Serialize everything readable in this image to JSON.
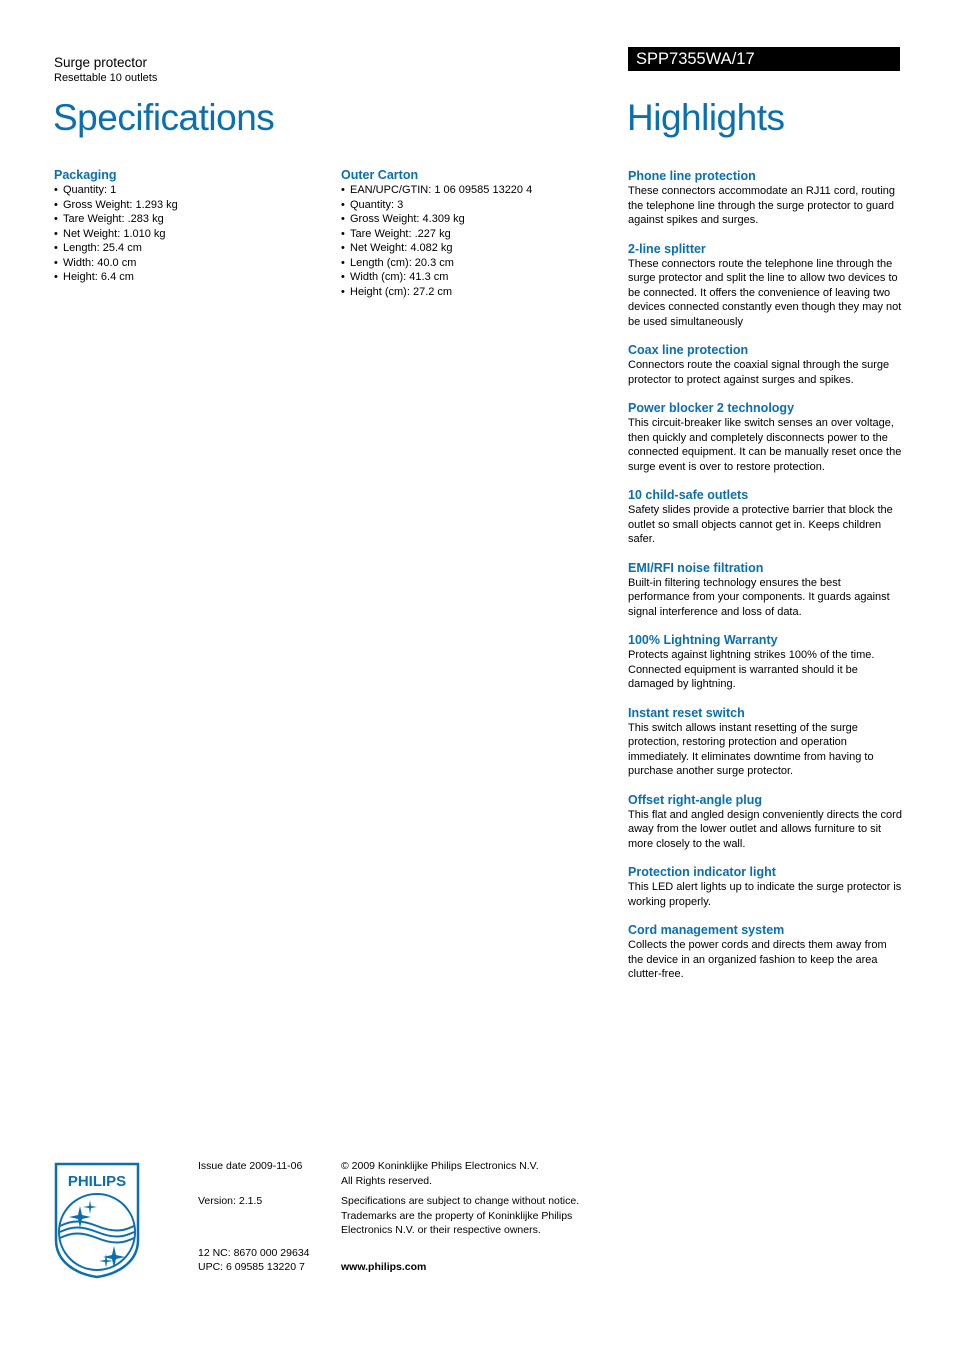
{
  "header": {
    "product_name": "Surge protector",
    "product_subtitle": "Resettable 10 outlets",
    "specifications_title": "Specifications",
    "model_number": "SPP7355WA/17",
    "highlights_title": "Highlights"
  },
  "colors": {
    "accent": "#0b6eaf",
    "model_bar_bg": "#000000",
    "model_bar_text": "#ffffff"
  },
  "specifications": [
    {
      "title": "Packaging",
      "items": [
        "Quantity: 1",
        "Gross Weight: 1.293 kg",
        "Tare Weight: .283 kg",
        "Net Weight: 1.010 kg",
        "Length: 25.4 cm",
        "Width: 40.0 cm",
        "Height: 6.4 cm"
      ]
    },
    {
      "title": "Outer Carton",
      "items": [
        "EAN/UPC/GTIN: 1 06 09585 13220 4",
        "Quantity: 3",
        "Gross Weight: 4.309 kg",
        "Tare Weight: .227 kg",
        "Net Weight: 4.082 kg",
        "Length (cm): 20.3 cm",
        "Width (cm): 41.3 cm",
        "Height (cm): 27.2 cm"
      ]
    }
  ],
  "highlights": [
    {
      "title": "Phone line protection",
      "text": "These connectors accommodate an RJ11 cord, routing the telephone line through the surge protector to guard against spikes and surges."
    },
    {
      "title": "2-line splitter",
      "text": "These connectors route the telephone line through the surge protector and split the line to allow two devices to be connected. It offers the convenience of leaving two devices connected constantly even though they may not be used simultaneously"
    },
    {
      "title": "Coax line protection",
      "text": "Connectors route the coaxial signal through the surge protector to protect against surges and spikes."
    },
    {
      "title": "Power blocker 2 technology",
      "text": "This circuit-breaker like switch senses an over voltage, then quickly and completely disconnects power to the connected equipment. It can be manually reset once the surge event is over to restore protection."
    },
    {
      "title": "10 child-safe outlets",
      "text": "Safety slides provide a protective barrier that block the outlet so small objects cannot get in. Keeps children safer."
    },
    {
      "title": "EMI/RFI noise filtration",
      "text": "Built-in filtering technology ensures the best performance from your components. It guards against signal interference and loss of data."
    },
    {
      "title": "100% Lightning Warranty",
      "text": "Protects against lightning strikes 100% of the time. Connected equipment is warranted should it be damaged by lightning."
    },
    {
      "title": "Instant reset switch",
      "text": "This switch allows instant resetting of the surge protection, restoring protection and operation immediately. It eliminates downtime from having to purchase another surge protector."
    },
    {
      "title": "Offset right-angle plug",
      "text": "This flat and angled design conveniently directs the cord away from the lower outlet and allows furniture to sit more closely to the wall."
    },
    {
      "title": "Protection indicator light",
      "text": "This LED alert lights up to indicate the surge protector is working properly."
    },
    {
      "title": "Cord management system",
      "text": "Collects the power cords and directs them away from the device in an organized fashion to keep the area clutter-free."
    }
  ],
  "footer": {
    "logo_text": "PHILIPS",
    "issue_date": "Issue date 2009-11-06",
    "version": "Version: 2.1.5",
    "nc": "12 NC: 8670 000 29634",
    "upc": "UPC: 6 09585 13220 7",
    "copyright_line1": "© 2009 Koninklijke Philips Electronics N.V.",
    "copyright_line2": "All Rights reserved.",
    "disclaimer_line1": "Specifications are subject to change without notice.",
    "disclaimer_line2": "Trademarks are the property of Koninklijke Philips",
    "disclaimer_line3": "Electronics N.V. or their respective owners.",
    "website": "www.philips.com"
  }
}
